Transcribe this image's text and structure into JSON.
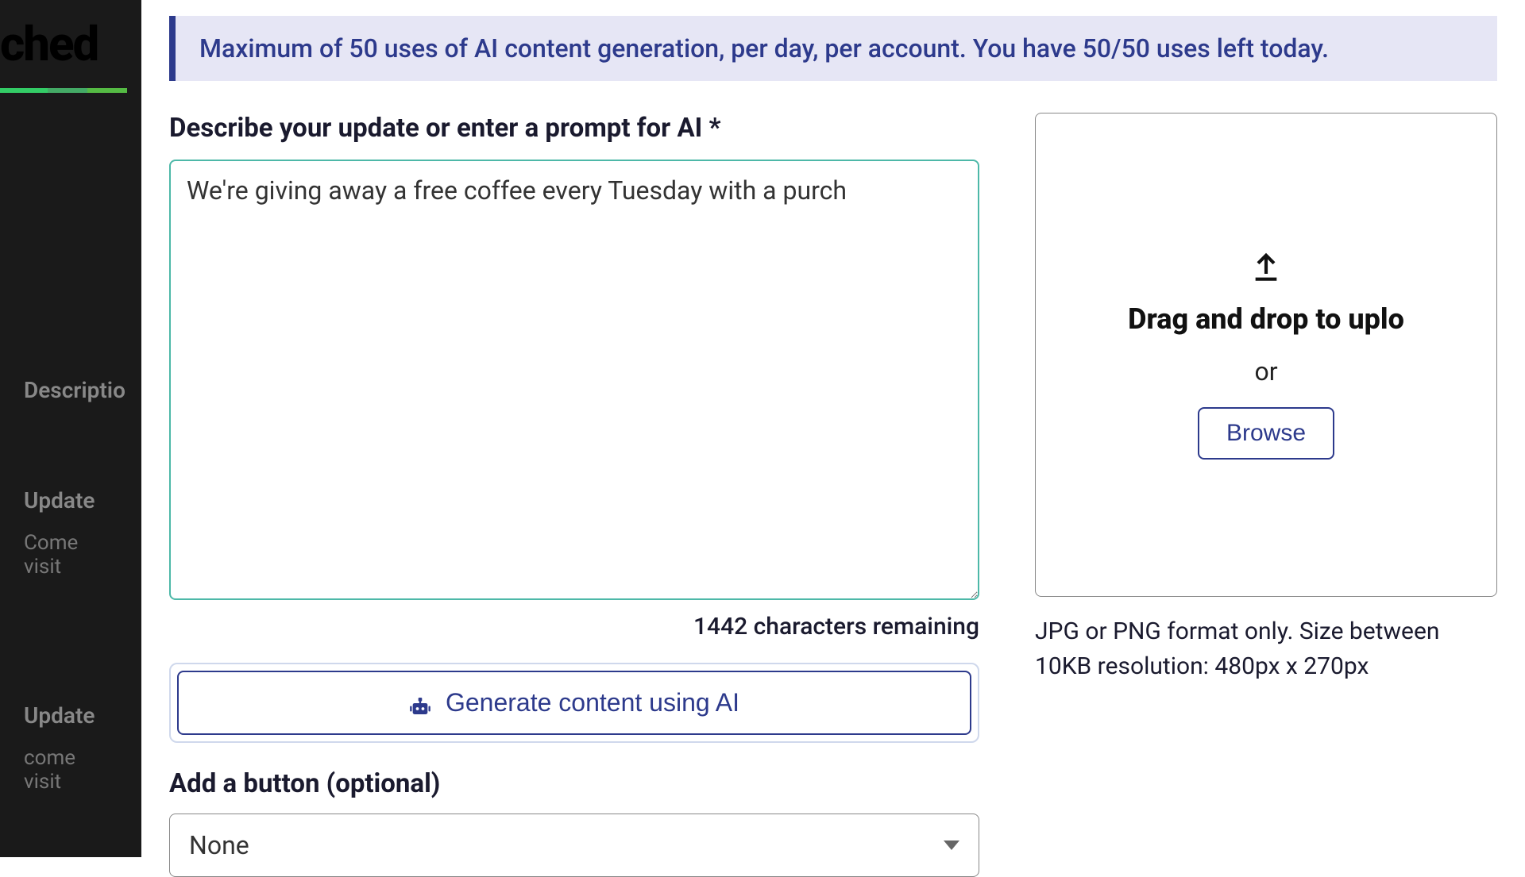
{
  "sidebar": {
    "logo_fragment": "ched",
    "items": {
      "description": "Descriptio",
      "update1_title": "Update",
      "update1_sub": "Come visit",
      "update2_title": "Update",
      "update2_sub": "come visit"
    }
  },
  "banner": {
    "text": "Maximum of 50 uses of AI content generation, per day, per account. You have 50/50 uses left today."
  },
  "form": {
    "prompt_label": "Describe your update or enter a prompt for AI *",
    "prompt_value": "We're giving away a free coffee every Tuesday with a purch",
    "char_remaining": "1442 characters remaining",
    "generate_label": "Generate content using AI",
    "button_section_label": "Add a button (optional)",
    "button_select_value": "None"
  },
  "upload": {
    "title": "Drag and drop to uplo",
    "or": "or",
    "browse": "Browse",
    "info": "JPG or PNG format only. Size between 10KB resolution: 480px x 270px"
  }
}
